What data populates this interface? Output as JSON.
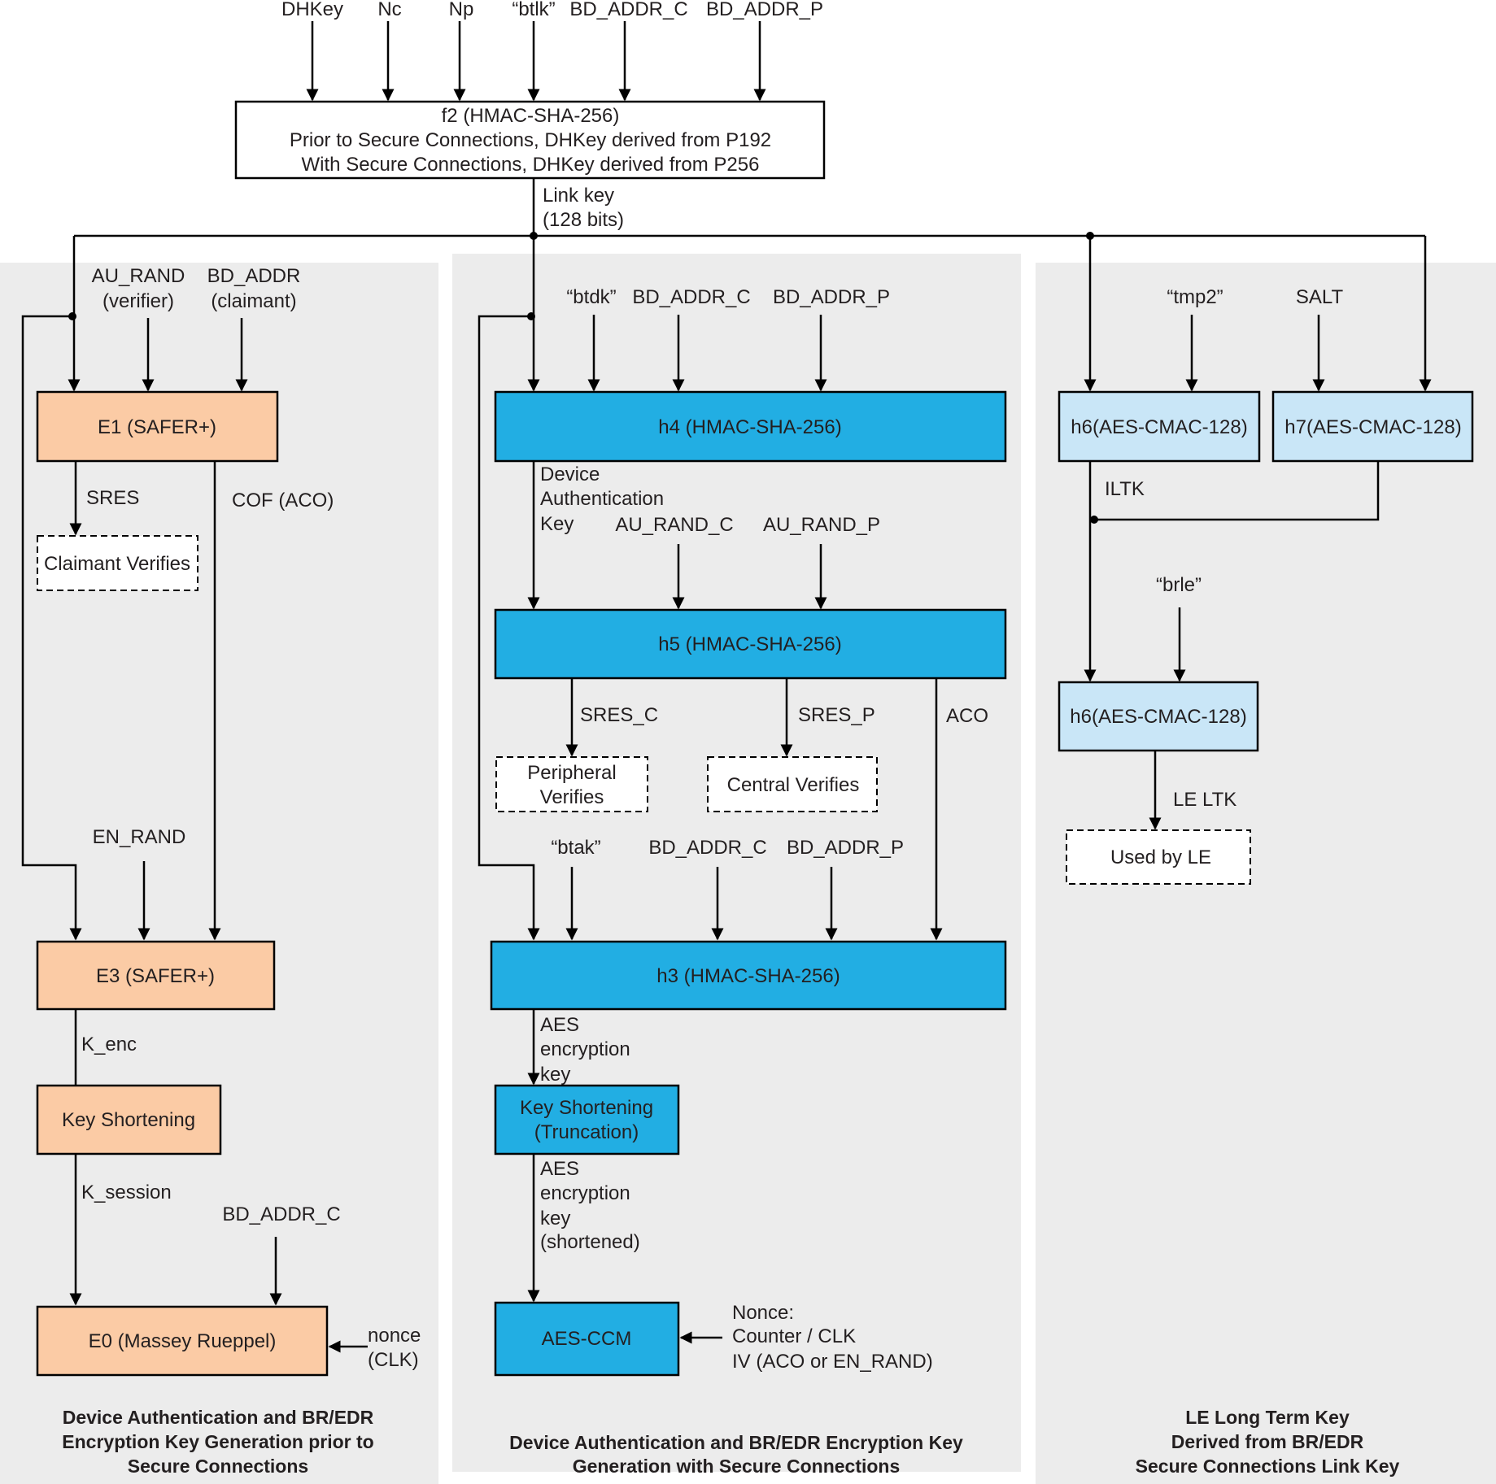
{
  "top": {
    "inputs": [
      "DHKey",
      "Nc",
      "Np",
      "“btlk”",
      "BD_ADDR_C",
      "BD_ADDR_P"
    ],
    "f2": {
      "title": "f2 (HMAC-SHA-256)",
      "line1": "Prior to Secure Connections, DHKey derived from P192",
      "line2": "With Secure Connections, DHKey derived from P256"
    },
    "link_key": [
      "Link key",
      "(128 bits)"
    ]
  },
  "left": {
    "e1_inputs": [
      [
        "AU_RAND",
        "(verifier)"
      ],
      [
        "BD_ADDR",
        "(claimant)"
      ]
    ],
    "e1": "E1 (SAFER+)",
    "sres": "SRES",
    "claimant_verifies": "Claimant Verifies",
    "cof": "COF (ACO)",
    "en_rand": "EN_RAND",
    "e3": "E3 (SAFER+)",
    "k_enc": "K_enc",
    "key_shortening": "Key Shortening",
    "k_session": "K_session",
    "bd_addr_c": "BD_ADDR_C",
    "e0": "E0 (Massey Rueppel)",
    "nonce": [
      "nonce",
      "(CLK)"
    ],
    "caption": [
      "Device Authentication and BR/EDR",
      "Encryption Key Generation prior to",
      "Secure Connections"
    ]
  },
  "middle": {
    "h4_inputs": [
      "“btdk”",
      "BD_ADDR_C",
      "BD_ADDR_P"
    ],
    "h4": "h4 (HMAC-SHA-256)",
    "dak": [
      "Device",
      "Authentication",
      "Key"
    ],
    "h5_inputs": [
      "AU_RAND_C",
      "AU_RAND_P"
    ],
    "h5": "h5 (HMAC-SHA-256)",
    "sres_c": "SRES_C",
    "sres_p": "SRES_P",
    "aco": "ACO",
    "peripheral_verifies": [
      "Peripheral",
      "Verifies"
    ],
    "central_verifies": "Central Verifies",
    "h3_inputs": [
      "“btak”",
      "BD_ADDR_C",
      "BD_ADDR_P"
    ],
    "h3": "h3 (HMAC-SHA-256)",
    "aes_key": [
      "AES",
      "encryption",
      "key"
    ],
    "key_shortening": [
      "Key Shortening",
      "(Truncation)"
    ],
    "aes_key_short": [
      "AES",
      "encryption",
      "key",
      "(shortened)"
    ],
    "aes_ccm": "AES-CCM",
    "nonce": [
      "Nonce:",
      "Counter / CLK",
      "IV (ACO or EN_RAND)"
    ],
    "caption": [
      "Device Authentication and BR/EDR Encryption Key",
      "Generation with Secure Connections"
    ]
  },
  "right": {
    "tmp2": "“tmp2”",
    "salt": "SALT",
    "h6": "h6(AES-CMAC-128)",
    "h7": "h7(AES-CMAC-128)",
    "iltk": "ILTK",
    "brle": "“brle”",
    "h6b": "h6(AES-CMAC-128)",
    "le_ltk": "LE LTK",
    "used_by_le": "Used by LE",
    "caption": [
      "LE Long Term Key",
      "Derived from BR/EDR",
      "Secure Connections Link Key"
    ]
  },
  "colors": {
    "legacy_box": "#fbcba5",
    "sc_box": "#22aee3",
    "le_box": "#c9e6f7",
    "panel": "#ececec"
  }
}
